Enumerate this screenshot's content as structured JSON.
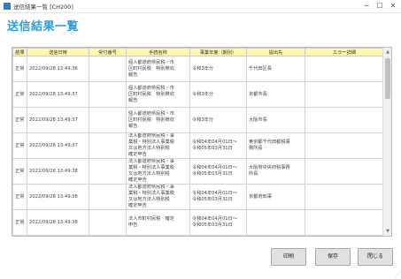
{
  "window": {
    "title": "送信結果一覧 [CH200]",
    "minimize": "─",
    "maximize": "☐",
    "close": "✕"
  },
  "page": {
    "heading": "送信結果一覧"
  },
  "table": {
    "headers": [
      "結果",
      "送信日時",
      "受付番号",
      "手続名称",
      "事業年度（期別）",
      "提出先",
      "エラー詳細"
    ],
    "rows": [
      {
        "status": "正常",
        "sent": "2022/09/28 13:49:36",
        "receipt": "",
        "procedure": "個人都道府県民税・市\n区町村民税　特別徴収\n報告",
        "period": "令和3年分",
        "destination": "千代田区長",
        "error": ""
      },
      {
        "status": "正常",
        "sent": "2022/09/28 13:49:37",
        "receipt": "",
        "procedure": "個人都道府県民税・市\n区町村民税　特別徴収\n報告",
        "period": "令和3年分",
        "destination": "京都市長",
        "error": ""
      },
      {
        "status": "正常",
        "sent": "2022/09/28 13:49:37",
        "receipt": "",
        "procedure": "個人都道府県民税・市\n区町村民税　特別徴収\n報告",
        "period": "令和3年分",
        "destination": "大阪市長",
        "error": ""
      },
      {
        "status": "正常",
        "sent": "2022/09/28 13:49:37",
        "receipt": "",
        "procedure": "法人都道府県民税・事\n業税・特別法人事業税\n又は地方法人特別税\n確定申告",
        "period": "令和04年04月01日～\n令和05年03月31日",
        "destination": "東京都千代田都税事\n務所長",
        "error": ""
      },
      {
        "status": "正常",
        "sent": "2022/09/28 13:49:38",
        "receipt": "",
        "procedure": "法人都道府県民税・事\n業税・特別法人事業税\n又は地方法人特別税\n確定申告",
        "period": "令和04年04月01日～\n令和05年03月31日",
        "destination": "大阪府中央府税事務\n所長",
        "error": ""
      },
      {
        "status": "正常",
        "sent": "2022/09/28 13:49:38",
        "receipt": "",
        "procedure": "法人都道府県民税・事\n業税・特別法人事業税\n又は地方法人特別税\n確定申告",
        "period": "令和04年04月01日～\n令和05年03月31日",
        "destination": "京都府知事",
        "error": ""
      },
      {
        "status": "正常",
        "sent": "2022/09/28 13:49:38",
        "receipt": "",
        "procedure": "法人市町村民税　確定\n申告",
        "period": "令和04年04月01日～\n令和05年03月31日",
        "destination": "",
        "error": ""
      }
    ]
  },
  "buttons": {
    "print": "印刷",
    "save": "保存",
    "close": "閉じる"
  }
}
